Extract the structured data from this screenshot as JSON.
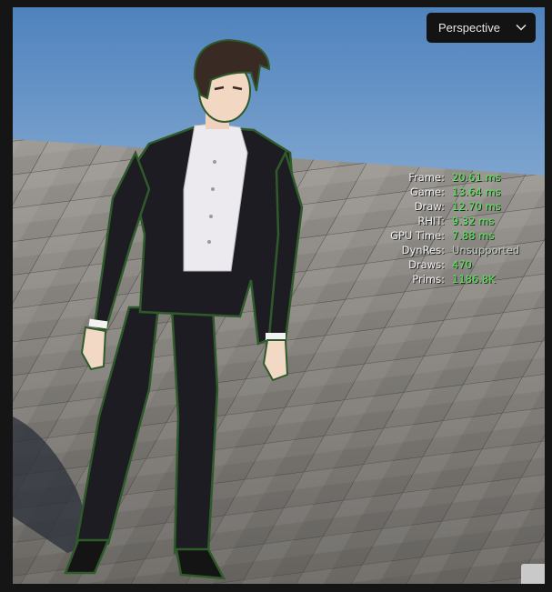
{
  "viewport": {
    "view_mode_label": "Perspective",
    "view_mode_icon": "chevron-down-icon"
  },
  "stats": [
    {
      "label": "Frame:",
      "value": "20.61 ms"
    },
    {
      "label": "Game:",
      "value": "13.64 ms"
    },
    {
      "label": "Draw:",
      "value": "12.70 ms"
    },
    {
      "label": "RHIT:",
      "value": "9.32 ms"
    },
    {
      "label": "GPU Time:",
      "value": "7.88 ms"
    },
    {
      "label": "DynRes:",
      "value": "Unsupported"
    },
    {
      "label": "Draws:",
      "value": "470"
    },
    {
      "label": "Prims:",
      "value": "1186.8K"
    }
  ],
  "colors": {
    "sky": "#5f8fc4",
    "floor": "#8a8580",
    "stat_value": "#5ce65c",
    "suit": "#1c1c22",
    "outline": "#2f5a2a"
  }
}
